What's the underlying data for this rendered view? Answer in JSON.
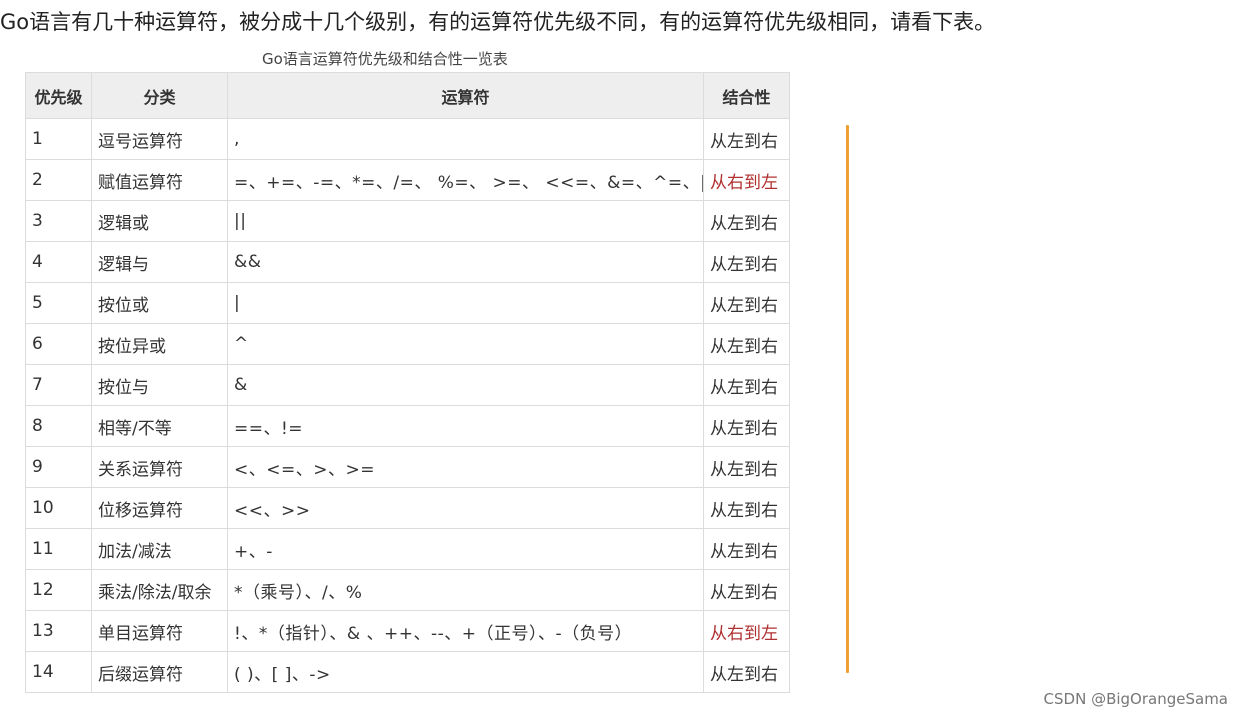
{
  "intro": "Go语言有几十种运算符，被分成十几个级别，有的运算符优先级不同，有的运算符优先级相同，请看下表。",
  "caption": "Go语言运算符优先级和结合性一览表",
  "table": {
    "headers": [
      "优先级",
      "分类",
      "运算符",
      "结合性"
    ],
    "rows": [
      {
        "level": "1",
        "category": "逗号运算符",
        "operators": ",",
        "assoc": "从左到右"
      },
      {
        "level": "2",
        "category": "赋值运算符",
        "operators": "=、+=、-=、*=、/=、 %=、 >=、 <<=、&=、^=、|=",
        "assoc": "从右到左"
      },
      {
        "level": "3",
        "category": "逻辑或",
        "operators": "||",
        "assoc": "从左到右"
      },
      {
        "level": "4",
        "category": "逻辑与",
        "operators": "&&",
        "assoc": "从左到右"
      },
      {
        "level": "5",
        "category": "按位或",
        "operators": "|",
        "assoc": "从左到右"
      },
      {
        "level": "6",
        "category": "按位异或",
        "operators": "^",
        "assoc": "从左到右"
      },
      {
        "level": "7",
        "category": "按位与",
        "operators": "&",
        "assoc": "从左到右"
      },
      {
        "level": "8",
        "category": "相等/不等",
        "operators": "==、!=",
        "assoc": "从左到右"
      },
      {
        "level": "9",
        "category": "关系运算符",
        "operators": "<、<=、>、>=",
        "assoc": "从左到右"
      },
      {
        "level": "10",
        "category": "位移运算符",
        "operators": "<<、>>",
        "assoc": "从左到右"
      },
      {
        "level": "11",
        "category": "加法/减法",
        "operators": "+、-",
        "assoc": "从左到右"
      },
      {
        "level": "12",
        "category": "乘法/除法/取余",
        "operators": "*（乘号）、/、%",
        "assoc": "从左到右"
      },
      {
        "level": "13",
        "category": "单目运算符",
        "operators": "!、*（指针）、& 、++、--、+（正号）、-（负号）",
        "assoc": "从右到左"
      },
      {
        "level": "14",
        "category": "后缀运算符",
        "operators": "( )、[ ]、->",
        "assoc": "从左到右"
      }
    ]
  },
  "watermark": "CSDN @BigOrangeSama",
  "colors": {
    "header_bg": "#eeeeee",
    "border": "#dcdcdc",
    "rtl_text": "#b03030",
    "accent_line": "#f0a030"
  }
}
